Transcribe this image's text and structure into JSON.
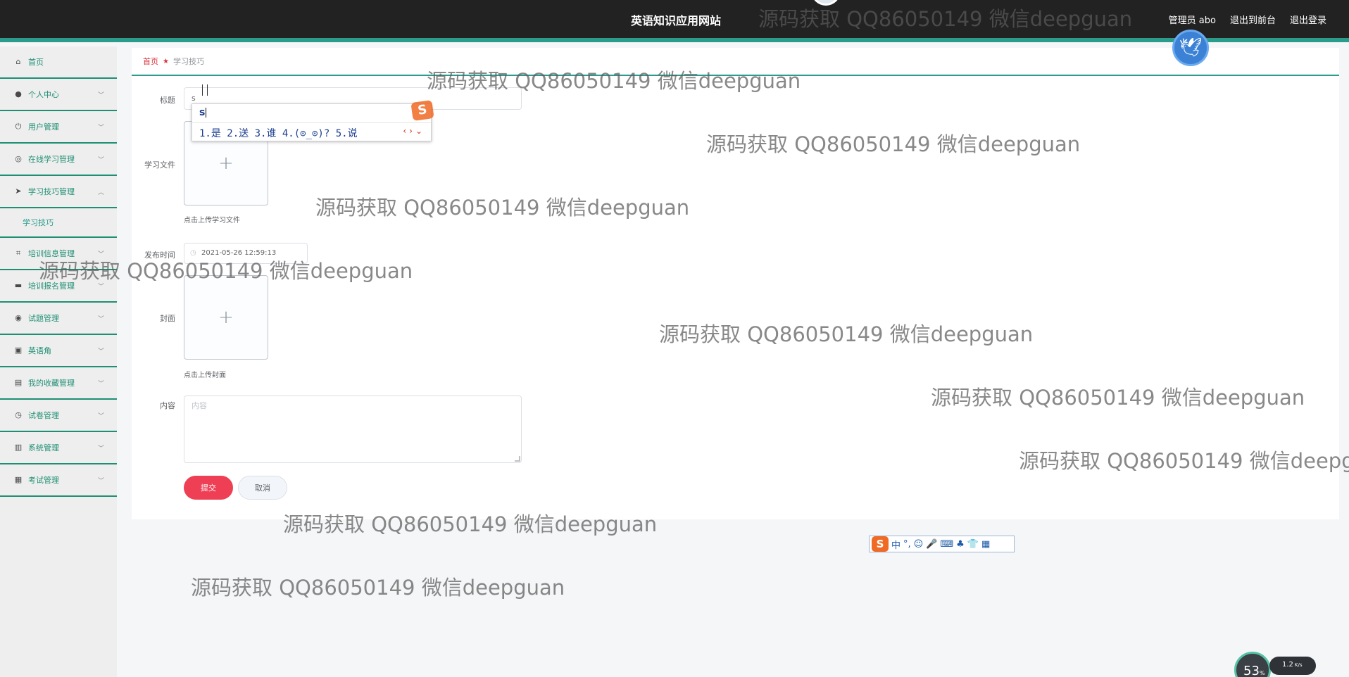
{
  "header": {
    "site_title": "英语知识应用网站",
    "user_label": "管理员 abo",
    "to_front": "退出到前台",
    "logout": "退出登录"
  },
  "sidebar": {
    "items": [
      {
        "label": "首页",
        "icon": "home-icon"
      },
      {
        "label": "个人中心",
        "icon": "user-icon"
      },
      {
        "label": "用户管理",
        "icon": "power-icon"
      },
      {
        "label": "在线学习管理",
        "icon": "compass-icon"
      },
      {
        "label": "学习技巧管理",
        "icon": "send-icon",
        "expanded": true
      },
      {
        "label": "学习技巧",
        "sub": true
      },
      {
        "label": "培训信息管理",
        "icon": "crop-icon"
      },
      {
        "label": "培训报名管理",
        "icon": "message-icon"
      },
      {
        "label": "试题管理",
        "icon": "globe-icon"
      },
      {
        "label": "英语角",
        "icon": "briefcase-icon"
      },
      {
        "label": "我的收藏管理",
        "icon": "printer-icon"
      },
      {
        "label": "试卷管理",
        "icon": "clock-icon"
      },
      {
        "label": "系统管理",
        "icon": "clipboard-icon"
      },
      {
        "label": "考试管理",
        "icon": "clipboard-check-icon"
      }
    ]
  },
  "breadcrumb": {
    "home": "首页",
    "current": "学习技巧"
  },
  "form": {
    "title_label": "标题",
    "title_value": "s",
    "file_label": "学习文件",
    "file_tip": "点击上传学习文件",
    "time_label": "发布时间",
    "time_value": "2021-05-26 12:59:13",
    "cover_label": "封面",
    "cover_tip": "点击上传封面",
    "content_label": "内容",
    "content_placeholder": "内容",
    "submit": "提交",
    "cancel": "取消"
  },
  "ime": {
    "code": "s",
    "candidates": "1.是  2.送  3.谁  4.(⊙_⊙)?  5.说",
    "toolbar": [
      "中",
      "°,",
      "☺",
      "🎤",
      "⌨",
      "♣",
      "👕",
      "▦"
    ]
  },
  "meter": {
    "percent": "53",
    "percent_unit": "%",
    "speed": "1.2",
    "speed_unit": "K/s"
  },
  "watermark": "源码获取 QQ86050149 微信deepguan"
}
